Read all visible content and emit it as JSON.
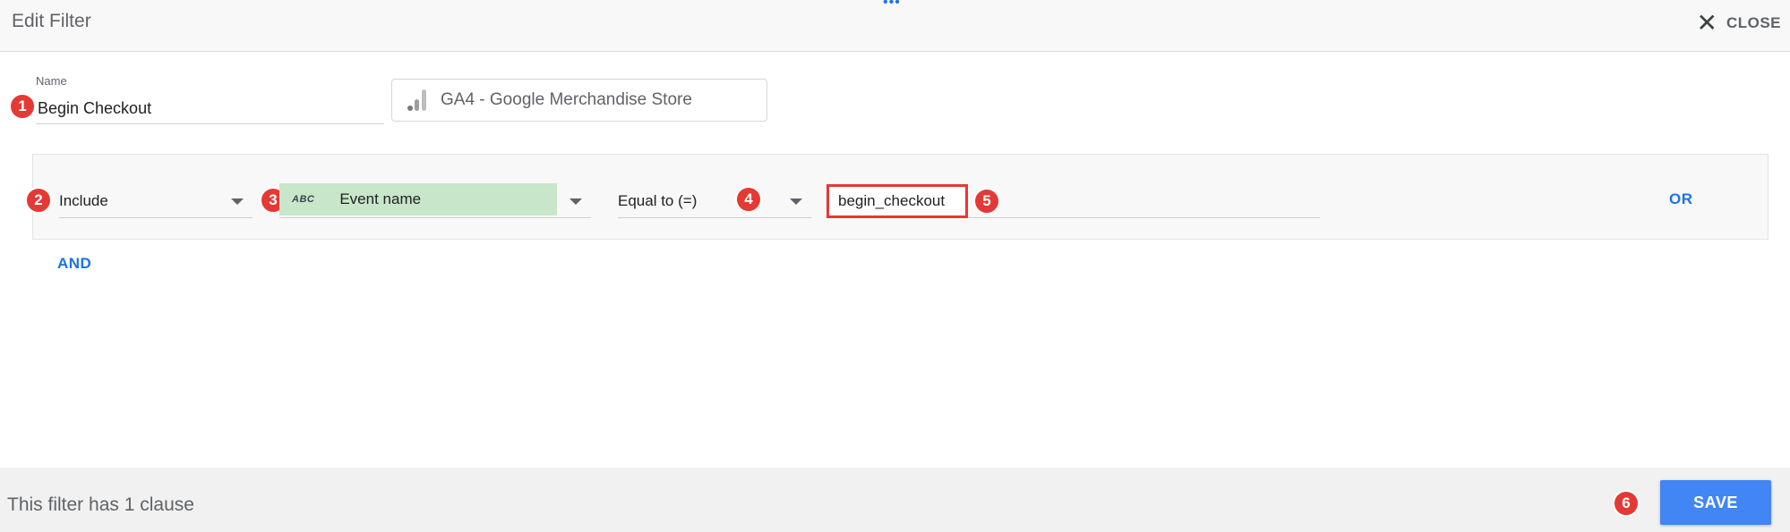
{
  "header": {
    "title": "Edit Filter",
    "close_label": "CLOSE"
  },
  "name_field": {
    "label": "Name",
    "value": "Begin Checkout"
  },
  "data_source": {
    "label": "GA4 - Google Merchandise Store"
  },
  "clause": {
    "include_exclude": "Include",
    "field_type_badge": "ABC",
    "field": "Event name",
    "operator": "Equal to (=)",
    "value": "begin_checkout",
    "or_label": "OR"
  },
  "and_label": "AND",
  "footer": {
    "clause_summary": "This filter has 1 clause",
    "save_label": "SAVE"
  },
  "annotations": [
    "1",
    "2",
    "3",
    "4",
    "5",
    "6"
  ],
  "colors": {
    "accent": "#4285f4",
    "link": "#1a73e8",
    "annotation": "#e53935",
    "field_chip": "#c8e6c9"
  }
}
